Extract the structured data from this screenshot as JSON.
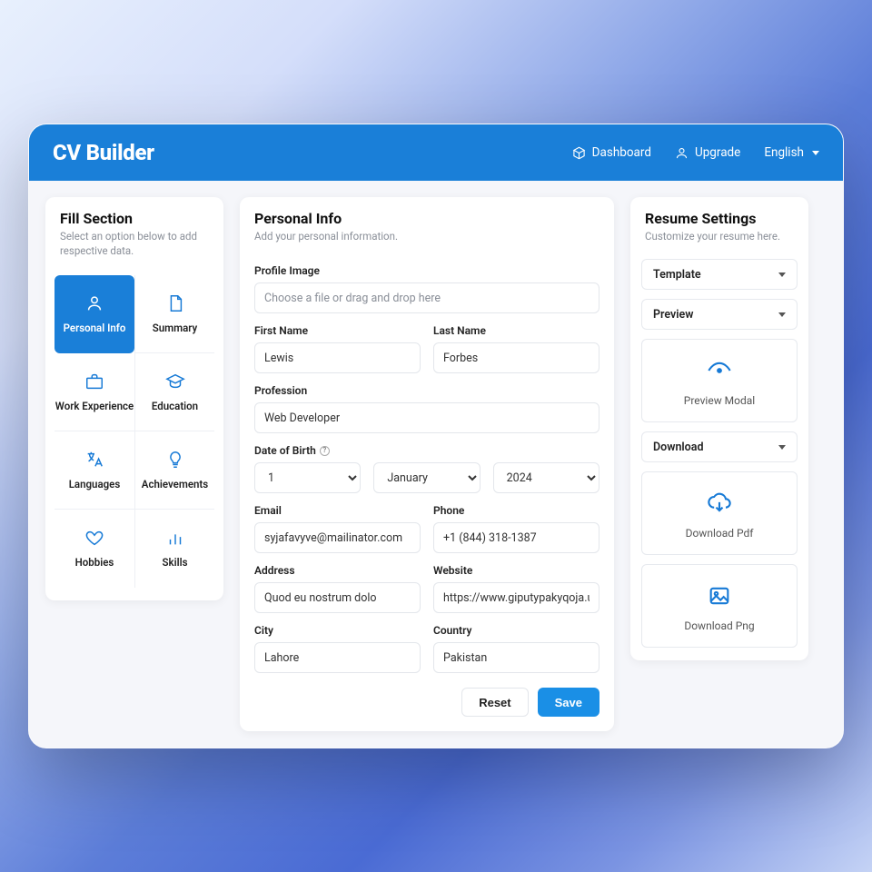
{
  "header": {
    "brand": "CV Builder",
    "dashboard": "Dashboard",
    "upgrade": "Upgrade",
    "language": "English"
  },
  "left": {
    "title": "Fill Section",
    "subtitle": "Select an option below to add respective data.",
    "tiles": {
      "personal": "Personal Info",
      "summary": "Summary",
      "work": "Work Experience",
      "education": "Education",
      "languages": "Languages",
      "achievements": "Achievements",
      "hobbies": "Hobbies",
      "skills": "Skills"
    }
  },
  "center": {
    "title": "Personal Info",
    "subtitle": "Add your personal information.",
    "labels": {
      "profile_image": "Profile Image",
      "first_name": "First Name",
      "last_name": "Last Name",
      "profession": "Profession",
      "dob": "Date of Birth",
      "email": "Email",
      "phone": "Phone",
      "address": "Address",
      "website": "Website",
      "city": "City",
      "country": "Country"
    },
    "values": {
      "dropzone": "Choose a file or drag and drop here",
      "first_name": "Lewis",
      "last_name": "Forbes",
      "profession": "Web Developer",
      "dob_day": "1",
      "dob_month": "January",
      "dob_year": "2024",
      "email": "syjafavyve@mailinator.com",
      "phone": "+1 (844) 318-1387",
      "address": "Quod eu nostrum dolo",
      "website": "https://www.giputypakyqoja.us",
      "city": "Lahore",
      "country": "Pakistan"
    },
    "buttons": {
      "reset": "Reset",
      "save": "Save"
    }
  },
  "right": {
    "title": "Resume Settings",
    "subtitle": "Customize your resume here.",
    "template": "Template",
    "preview": "Preview",
    "preview_modal": "Preview Modal",
    "download": "Download",
    "download_pdf": "Download Pdf",
    "download_png": "Download Png"
  }
}
